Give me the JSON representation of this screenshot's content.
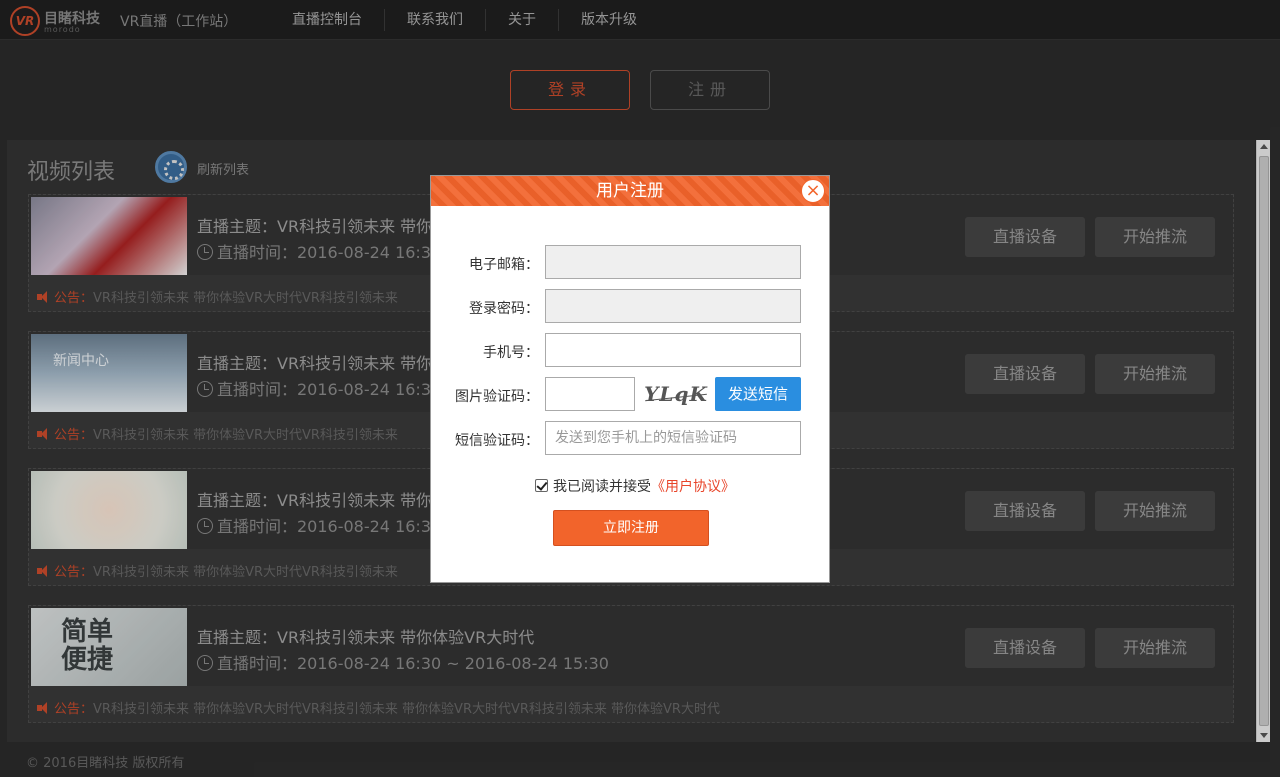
{
  "header": {
    "logo_mark": "VR",
    "logo_name": "目睹科技",
    "logo_sub": "morodo",
    "app_title": "VR直播（工作站）",
    "nav": [
      "直播控制台",
      "联系我们",
      "关于",
      "版本升级"
    ]
  },
  "auth": {
    "login_label": "登录",
    "register_label": "注册"
  },
  "panel": {
    "title": "视频列表",
    "refresh_label": "刷新列表",
    "cards": [
      {
        "title": "直播主题：VR科技引领未来 带你",
        "time": "直播时间：2016-08-24 16:30",
        "notice_label": "公告：",
        "notice": "VR科技引领未来 带你体验VR大时代VR科技引领未来",
        "device_label": "直播设备",
        "stream_label": "开始推流"
      },
      {
        "title": "直播主题：VR科技引领未来 带你",
        "time": "直播时间：2016-08-24 16:30",
        "notice_label": "公告：",
        "notice": "VR科技引领未来 带你体验VR大时代VR科技引领未来",
        "device_label": "直播设备",
        "stream_label": "开始推流",
        "thumb_text": "新闻中心"
      },
      {
        "title": "直播主题：VR科技引领未来 带你",
        "time": "直播时间：2016-08-24 16:30",
        "notice_label": "公告：",
        "notice": "VR科技引领未来 带你体验VR大时代VR科技引领未来",
        "device_label": "直播设备",
        "stream_label": "开始推流"
      },
      {
        "title": "直播主题：VR科技引领未来 带你体验VR大时代",
        "time": "直播时间：2016-08-24 16:30 ~ 2016-08-24 15:30",
        "notice_label": "公告：",
        "notice": "VR科技引领未来 带你体验VR大时代VR科技引领未来 带你体验VR大时代VR科技引领未来 带你体验VR大时代",
        "device_label": "直播设备",
        "stream_label": "开始推流",
        "thumb_text": "简单便捷"
      }
    ]
  },
  "footer": "© 2016目睹科技  版权所有",
  "modal": {
    "title": "用户注册",
    "close": "×",
    "email_label": "电子邮箱：",
    "password_label": "登录密码：",
    "phone_label": "手机号：",
    "captcha_label": "图片验证码：",
    "captcha_text": "YLqK",
    "sms_button": "发送短信",
    "sms_label": "短信验证码：",
    "sms_placeholder": "发送到您手机上的短信验证码",
    "agree_text": "我已阅读并接受",
    "agree_link": "《用户协议》",
    "submit": "立即注册"
  },
  "colors": {
    "accent": "#f2642b",
    "link": "#e8452a",
    "sms_button": "#2a8ee0"
  }
}
